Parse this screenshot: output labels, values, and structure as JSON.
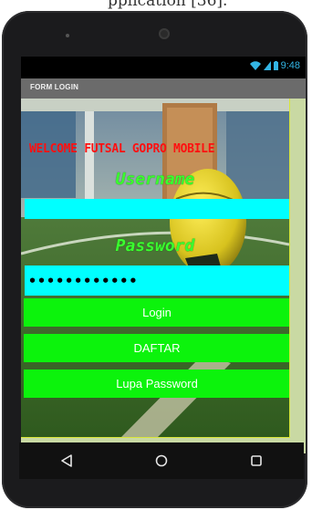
{
  "caption": {
    "text": "pplication [36]."
  },
  "status_bar": {
    "time": "9:48",
    "wifi_icon": "wifi-icon",
    "signal_icon": "signal-icon",
    "battery_icon": "battery-icon",
    "accent": "#33b5e5"
  },
  "action_bar": {
    "title": "FORM LOGIN"
  },
  "form": {
    "welcome": "WELCOME FUTSAL GOPRO MOBILE",
    "username_label": "Username",
    "username_value": "",
    "password_label": "Password",
    "password_value": "••••••••••••",
    "login_label": "Login",
    "register_label": "DAFTAR",
    "forgot_label": "Lupa Password"
  },
  "navigation": {
    "back_icon": "back-icon",
    "home_icon": "home-icon",
    "recents_icon": "recents-icon"
  },
  "colors": {
    "input_bg": "#00ffff",
    "button_bg": "#0cf30c",
    "welcome_text": "#ff1010",
    "label_text": "#3bff2f"
  }
}
